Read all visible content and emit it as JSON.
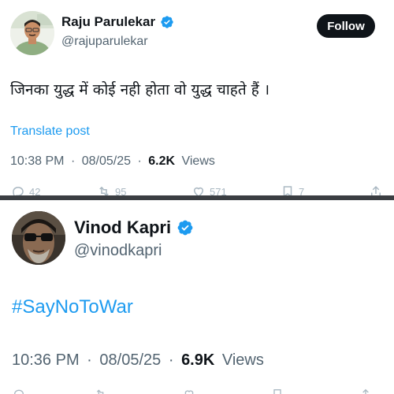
{
  "posts": [
    {
      "author_name": "Raju Parulekar",
      "handle": "@rajuparulekar",
      "follow_label": "Follow",
      "text": "जिनका युद्ध में कोई नही होता वो युद्ध चाहते हैं ।",
      "translate_label": "Translate post",
      "time": "10:38 PM",
      "date": "08/05/25",
      "views_count": "6.2K",
      "views_label": "Views",
      "separator": "·",
      "replies": "42",
      "reposts": "95",
      "likes": "571",
      "bookmarks": "7"
    },
    {
      "author_name": "Vinod Kapri",
      "handle": "@vinodkapri",
      "text": "#SayNoToWar",
      "time": "10:36 PM",
      "date": "08/05/25",
      "views_count": "6.9K",
      "views_label": "Views",
      "separator": "·"
    }
  ],
  "colors": {
    "link_blue": "#1d9bf0",
    "text_primary": "#0f1419",
    "text_secondary": "#536471",
    "verified_blue": "#1d9bf0",
    "follow_bg": "#0f1419",
    "divider": "#3b3e42"
  },
  "icons": [
    "verified-badge-icon",
    "reply-icon",
    "repost-icon",
    "like-icon",
    "views-icon",
    "bookmark-icon",
    "share-icon"
  ]
}
